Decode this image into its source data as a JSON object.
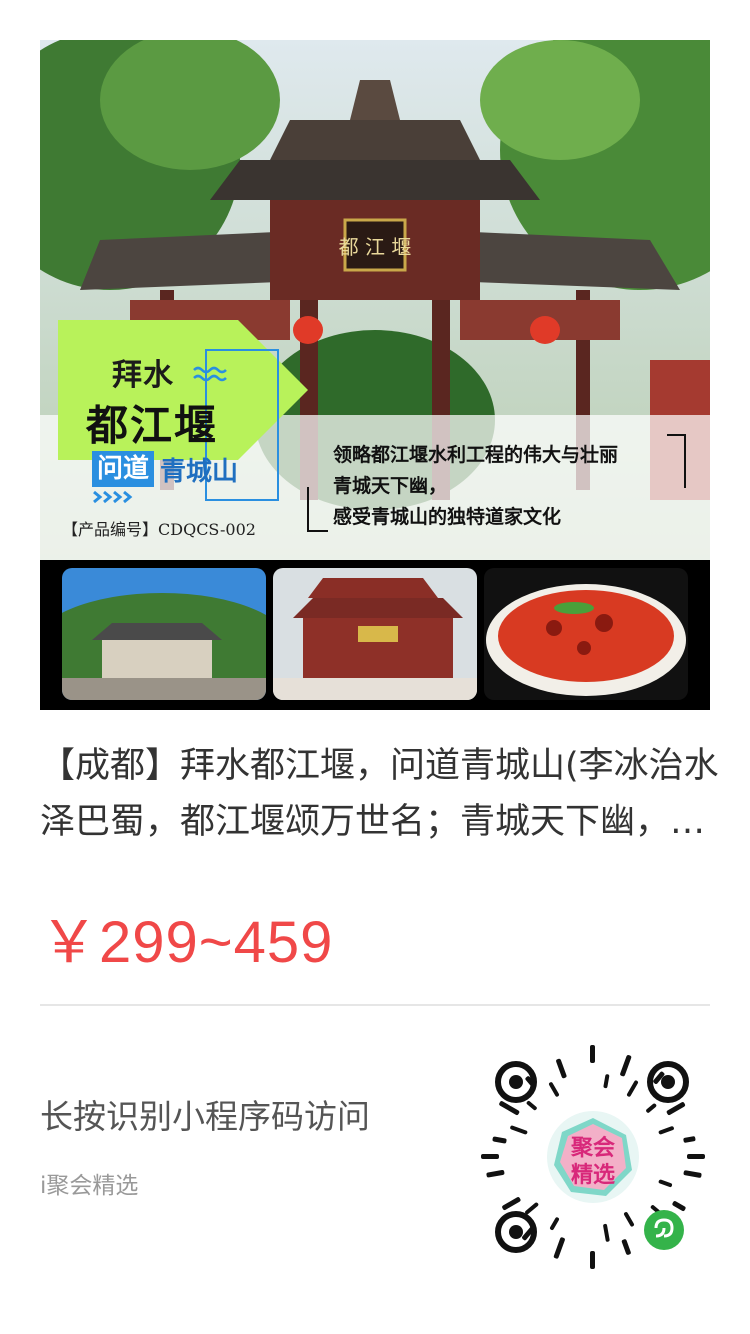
{
  "poster": {
    "title_line1": "拜水",
    "title_line2": "都江堰",
    "title_tag": "问道",
    "title_line3": "青城山",
    "gate_plaque": "都 江 堰",
    "product_code": "【产品编号】CDQCS-002",
    "slogan": [
      "领略都江堰水利工程的伟大与壮丽",
      "青城天下幽，",
      "感受青城山的独特道家文化"
    ],
    "thumbnails": [
      "scenic-gate-photo",
      "pagoda-temple-photo",
      "spicy-fish-dish-photo"
    ]
  },
  "product": {
    "title": "【成都】拜水都江堰，问道青城山(李冰治水泽巴蜀，都江堰颂万世名；青城天下幽，寻仙问道游)",
    "price": "￥299~459"
  },
  "footer": {
    "hint": "长按识别小程序码访问",
    "brand": "i聚会精选",
    "qr_center_text_1": "聚会",
    "qr_center_text_2": "精选"
  },
  "colors": {
    "price": "#f04848",
    "accent_green": "#b8f25a",
    "accent_blue": "#2a8fe0"
  }
}
